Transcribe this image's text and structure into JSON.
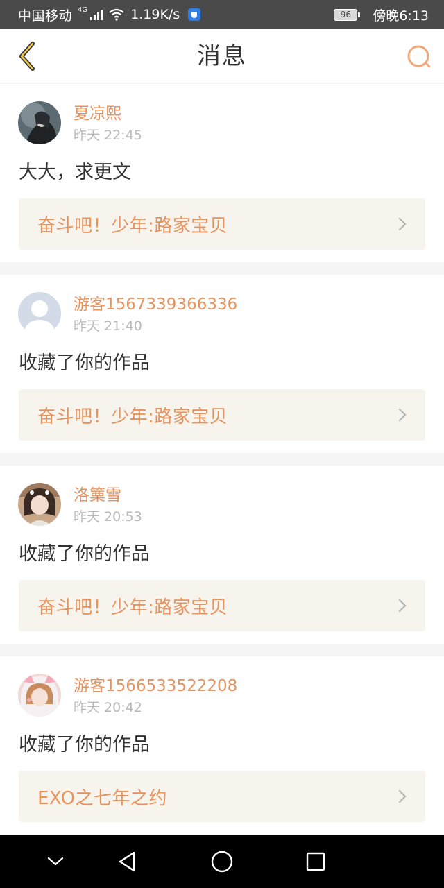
{
  "status_bar": {
    "carrier": "中国移动",
    "network": "4G",
    "speed": "1.19K/s",
    "battery": "96",
    "time": "傍晚6:13"
  },
  "header": {
    "title": "消息",
    "back_icon": "chevron-left-icon",
    "search_icon": "search-icon",
    "accent_color": "#e8935e"
  },
  "messages": [
    {
      "username": "夏凉熙",
      "time": "昨天 22:45",
      "content": "大大，求更文",
      "work": "奋斗吧！少年:路家宝贝"
    },
    {
      "username": "游客1567339366336",
      "time": "昨天 21:40",
      "content": "收藏了你的作品",
      "work": "奋斗吧！少年:路家宝贝"
    },
    {
      "username": "洛篥雪",
      "time": "昨天 20:53",
      "content": "收藏了你的作品",
      "work": "奋斗吧！少年:路家宝贝"
    },
    {
      "username": "游客1566533522208",
      "time": "昨天 20:42",
      "content": "收藏了你的作品",
      "work": "EXO之七年之约"
    }
  ],
  "system_nav": {
    "icons": [
      "chevron-down-icon",
      "back-triangle-icon",
      "home-circle-icon",
      "recents-square-icon"
    ]
  }
}
